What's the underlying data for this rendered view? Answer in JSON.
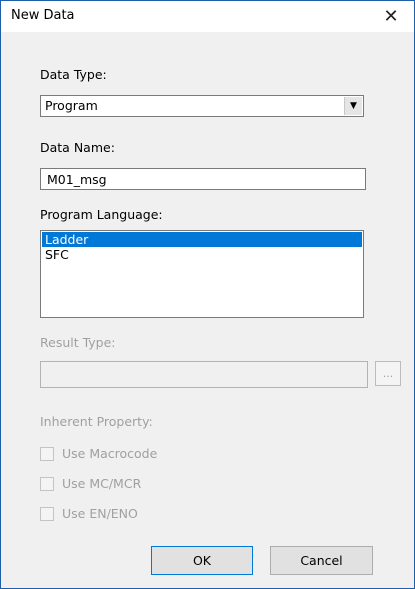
{
  "window": {
    "title": "New Data",
    "close_symbol": "✕"
  },
  "data_type": {
    "label": "Data Type:",
    "value": "Program",
    "dropdown_symbol": "▼"
  },
  "data_name": {
    "label": "Data Name:",
    "value": "M01_msg"
  },
  "program_language": {
    "label": "Program Language:",
    "items": [
      {
        "label": "Ladder",
        "selected": true
      },
      {
        "label": "SFC",
        "selected": false
      }
    ]
  },
  "result_type": {
    "label": "Result Type:",
    "value": "",
    "browse_label": "..."
  },
  "inherent_property": {
    "label": "Inherent Property:",
    "options": [
      {
        "label": "Use Macrocode",
        "checked": false,
        "enabled": false
      },
      {
        "label": "Use MC/MCR",
        "checked": false,
        "enabled": false
      },
      {
        "label": "Use EN/ENO",
        "checked": false,
        "enabled": false
      }
    ]
  },
  "buttons": {
    "ok_label": "OK",
    "cancel_label": "Cancel"
  }
}
